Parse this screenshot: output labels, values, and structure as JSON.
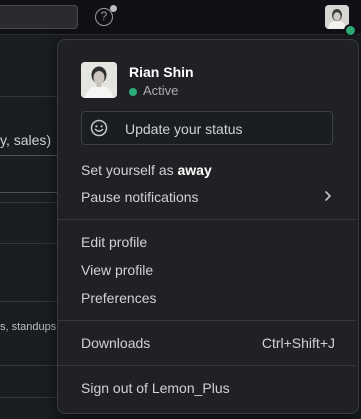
{
  "background": {
    "partial_text_1": "y, sales)",
    "partial_text_2": "s, standups"
  },
  "topbar": {
    "help_icon": "?"
  },
  "user": {
    "name": "Rian Shin",
    "status": "Active"
  },
  "menu": {
    "update_status": "Update your status",
    "set_away_prefix": "Set yourself as ",
    "set_away_bold": "away",
    "pause_notifications": "Pause notifications",
    "edit_profile": "Edit profile",
    "view_profile": "View profile",
    "preferences": "Preferences",
    "downloads": "Downloads",
    "downloads_shortcut": "Ctrl+Shift+J",
    "sign_out": "Sign out of Lemon_Plus"
  },
  "colors": {
    "active_green": "#2bac76",
    "menu_bg": "#1f2124"
  },
  "icons": {
    "help": "help-circle-icon",
    "smile": "smiley-icon",
    "chevron": "chevron-right-icon"
  }
}
